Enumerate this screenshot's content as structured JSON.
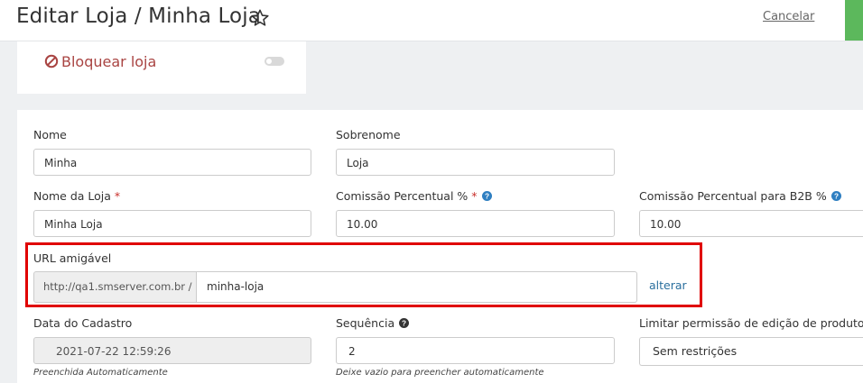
{
  "header": {
    "title": "Editar Loja / Minha Loja",
    "cancel_label": "Cancelar"
  },
  "block": {
    "label": "Bloquear loja",
    "enabled": false
  },
  "form": {
    "nome": {
      "label": "Nome",
      "value": "Minha"
    },
    "sobrenome": {
      "label": "Sobrenome",
      "value": "Loja"
    },
    "nome_loja": {
      "label": "Nome da Loja",
      "required_mark": "*",
      "value": "Minha Loja"
    },
    "comissao": {
      "label": "Comissão Percentual %",
      "required_mark": "*",
      "value": "10.00"
    },
    "comissao_b2b": {
      "label": "Comissão Percentual para B2B %",
      "value": "10.00"
    },
    "url": {
      "label": "URL amigável",
      "prefix": "http://qa1.smserver.com.br /",
      "value": "minha-loja",
      "alter_label": "alterar"
    },
    "data_cadastro": {
      "label": "Data do Cadastro",
      "value": "2021-07-22 12:59:26",
      "hint": "Preenchida Automaticamente"
    },
    "sequencia": {
      "label": "Sequência",
      "value": "2",
      "hint": "Deixe vazio para preencher automaticamente"
    },
    "limitar": {
      "label": "Limitar permissão de edição de produto",
      "value": "Sem restrições"
    }
  },
  "colors": {
    "danger": "#a94442",
    "highlight_border": "#e00000",
    "link": "#2a6f9e",
    "save": "#5cb85c",
    "help_icon": "#2f7fc1"
  }
}
